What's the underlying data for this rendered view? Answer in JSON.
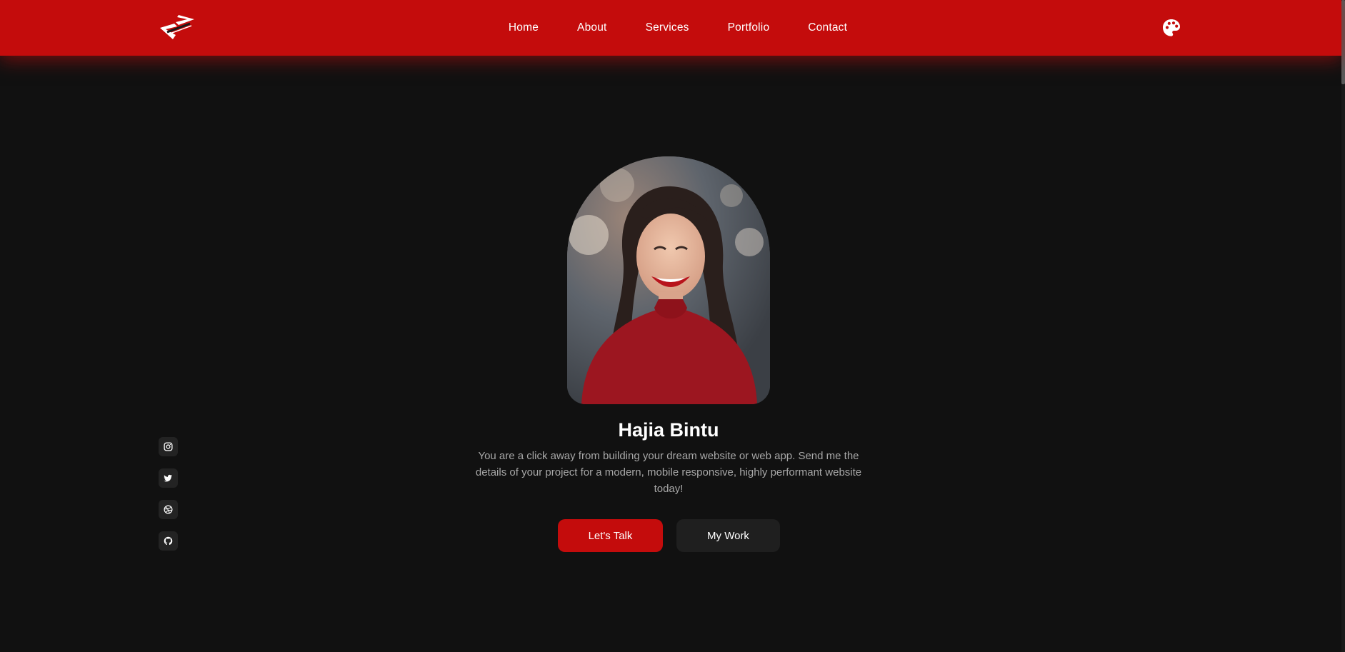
{
  "nav": {
    "logo_icon": "code-brackets-logo",
    "links": [
      "Home",
      "About",
      "Services",
      "Portfolio",
      "Contact"
    ],
    "theme_icon": "palette-icon"
  },
  "socials": [
    {
      "icon": "instagram-icon"
    },
    {
      "icon": "twitter-icon"
    },
    {
      "icon": "dribbble-icon"
    },
    {
      "icon": "github-icon"
    }
  ],
  "hero": {
    "name": "Hajia Bintu",
    "tagline": "You are a click away from building your dream website or web app. Send me the details of your project for a modern, mobile responsive, highly performant website today!",
    "primary_button": "Let's Talk",
    "secondary_button": "My Work"
  },
  "colors": {
    "accent": "#c40c0c",
    "background": "#111111",
    "surface": "#1f1f1f",
    "muted_text": "#a7a7a7"
  }
}
